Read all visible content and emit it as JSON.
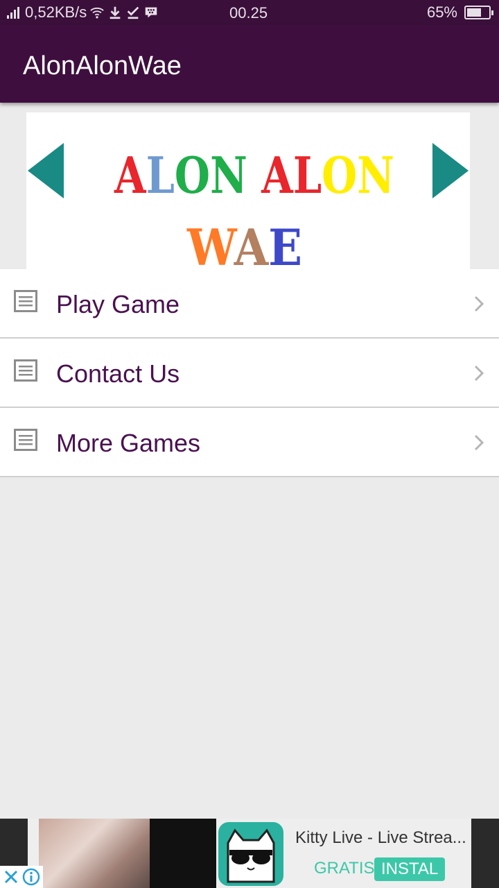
{
  "status_bar": {
    "network_speed": "0,52KB/s",
    "time": "00.25",
    "battery_percent": "65%",
    "battery_level": 0.65,
    "icons": [
      "signal-icon",
      "wifi-icon",
      "download-icon",
      "check-icon",
      "bbm-icon",
      "battery-icon"
    ]
  },
  "app_bar": {
    "title": "AlonAlonWae"
  },
  "banner": {
    "line1": "ALON ALON",
    "line2": "WAE",
    "arrow_color": "#198a84"
  },
  "menu": {
    "items": [
      {
        "label": "Play Game",
        "icon": "document-icon"
      },
      {
        "label": "Contact Us",
        "icon": "document-icon"
      },
      {
        "label": "More Games",
        "icon": "document-icon"
      }
    ],
    "label_color": "#4a1150"
  },
  "ad": {
    "title": "Kitty Live - Live Strea...",
    "gratis": "GRATIS",
    "install": "INSTAL",
    "accent_color": "#3cc8a8"
  },
  "colors": {
    "status_bar": "#3a0f3a",
    "app_bar": "#3e0f3e",
    "background": "#ebebeb"
  }
}
